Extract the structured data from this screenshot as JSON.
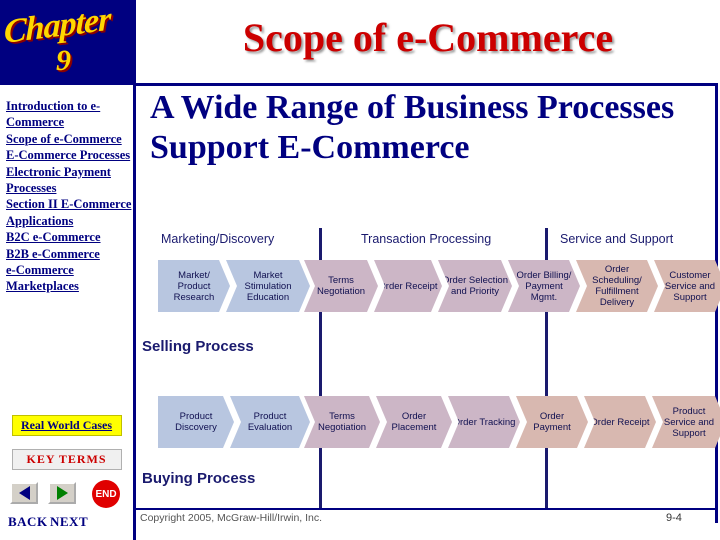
{
  "sidebar": {
    "chapter_word": "Chapter",
    "chapter_number": "9",
    "toc_items": [
      "Introduction to e-Commerce",
      "Scope of e-Commerce",
      "E-Commerce Processes",
      "Electronic Payment Processes",
      "Section II E-Commerce Applications",
      "B2C e-Commerce",
      "B2B e-Commerce",
      "e-Commerce Marketplaces"
    ],
    "real_world_cases": "Real World Cases",
    "key_terms": "KEY TERMS",
    "back_label": "BACK",
    "next_label": "NEXT",
    "end_label": "END"
  },
  "slide": {
    "title": "Scope of e-Commerce",
    "headline": "A Wide Range of Business Processes Support E-Commerce",
    "copyright": "Copyright 2005, McGraw-Hill/Irwin, Inc.",
    "slide_number": "9-4"
  },
  "diagram": {
    "phases": [
      "Marketing/Discovery",
      "Transaction Processing",
      "Service and Support"
    ],
    "selling_process_label": "Selling Process",
    "buying_process_label": "Buying Process",
    "selling_steps": [
      "Market/ Product Research",
      "Market Stimulation Education",
      "Terms Negotiation",
      "Order Receipt",
      "Order Selection and Priority",
      "Order Billing/ Payment Mgmt.",
      "Order Scheduling/ Fulfillment Delivery",
      "Customer Service and Support"
    ],
    "buying_steps": [
      "Product Discovery",
      "Product Evaluation",
      "Terms Negotiation",
      "Order Placement",
      "Order Tracking",
      "Order Payment",
      "Order Receipt",
      "Product Service and Support"
    ]
  },
  "colors": {
    "navy": "#000080",
    "title_red": "#cc0000",
    "banner_gold": "#ffd700",
    "highlight_yellow": "#ffff00"
  }
}
